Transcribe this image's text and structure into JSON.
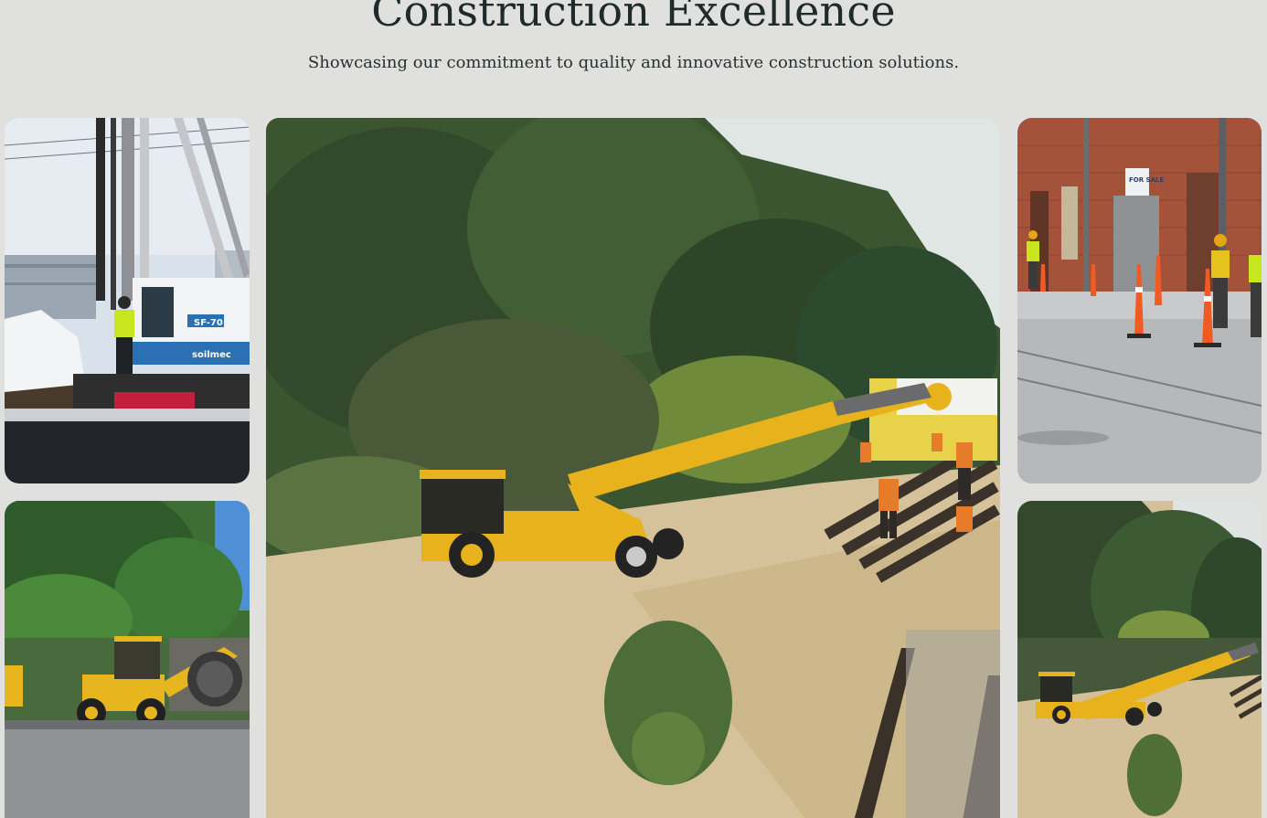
{
  "hero": {
    "title": "Construction Excellence",
    "subtitle": "Showcasing our commitment to quality and innovative construction solutions."
  },
  "gallery": {
    "photos": [
      {
        "id": "piling-rig",
        "subject": "Piling rig with worker in hi-vis vest on snowy site",
        "rig_label": "SF-70",
        "brand_label": "soilmec"
      },
      {
        "id": "backhoe-street",
        "subject": "Yellow backhoe loader parked on street with trees"
      },
      {
        "id": "rail-crane",
        "subject": "Yellow mobile crane and workers in orange laying rail track near forest"
      },
      {
        "id": "street-cones",
        "subject": "Workers with traffic cones in front of brick building",
        "sign_label": "FOR SALE"
      },
      {
        "id": "rail-crane-alt",
        "subject": "Another view of yellow crane at rail track site"
      }
    ]
  },
  "colors": {
    "background": "#e0e1de",
    "heading": "#1f2a2b",
    "machinery_yellow": "#e8b21c",
    "worker_orange": "#e67b2a",
    "foliage": "#3a5a30"
  }
}
